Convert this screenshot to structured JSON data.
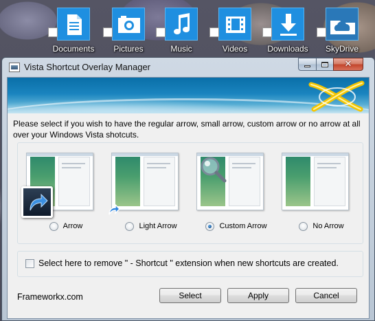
{
  "desktop": {
    "icons": [
      {
        "label": "Documents",
        "icon": "document-icon"
      },
      {
        "label": "Pictures",
        "icon": "camera-icon"
      },
      {
        "label": "Music",
        "icon": "music-note-icon"
      },
      {
        "label": "Videos",
        "icon": "film-icon"
      },
      {
        "label": "Downloads",
        "icon": "download-arrow-icon"
      },
      {
        "label": "SkyDrive",
        "icon": "cloud-folder-icon"
      }
    ],
    "tile_color": "#1f8fe0"
  },
  "window": {
    "title": "Vista Shortcut Overlay Manager",
    "description": "Please select if you wish to have the regular arrow, small arrow, custom arrow or no arrow at all over your Windows Vista shotcuts.",
    "options": [
      {
        "label": "Arrow",
        "selected": false
      },
      {
        "label": "Light Arrow",
        "selected": false
      },
      {
        "label": "Custom Arrow",
        "selected": true
      },
      {
        "label": "No Arrow",
        "selected": false
      }
    ],
    "remove_extension_label": "Select here to remove \" - Shortcut \" extension when new shortcuts are created.",
    "remove_extension_checked": false,
    "footer_link": "Frameworkx.com",
    "buttons": {
      "select": "Select",
      "apply": "Apply",
      "cancel": "Cancel"
    },
    "accent_color": "#1a84bf"
  }
}
